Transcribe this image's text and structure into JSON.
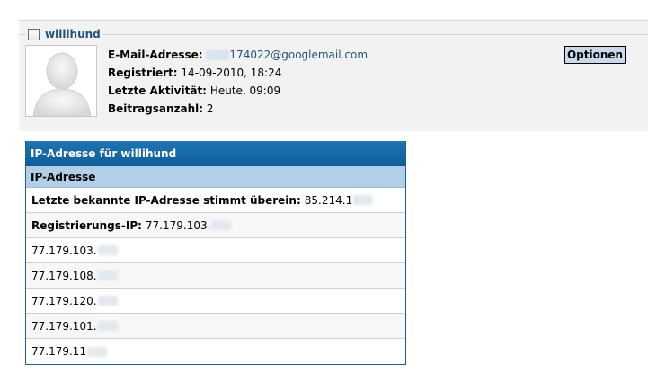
{
  "user": {
    "username": "willihund",
    "email_visible": "174022@googlemail.com",
    "fields": {
      "email_label": "E-Mail-Adresse:",
      "registered_label": "Registriert:",
      "registered_value": "14-09-2010, 18:24",
      "last_activity_label": "Letzte Aktivität:",
      "last_activity_value": "Heute, 09:09",
      "post_count_label": "Beitragsanzahl:",
      "post_count_value": "2"
    },
    "options_button": "Optionen"
  },
  "ip_table": {
    "title": "IP-Adresse für willihund",
    "column_header": "IP-Adresse",
    "last_ip_label": "Letzte bekannte IP-Adresse stimmt überein:",
    "last_ip_value": "85.214.1",
    "registration_ip_label": "Registrierungs-IP:",
    "registration_ip_value": "77.179.103.",
    "addresses": [
      "77.179.103.",
      "77.179.108.",
      "77.179.120.",
      "77.179.101.",
      "77.179.11"
    ]
  }
}
